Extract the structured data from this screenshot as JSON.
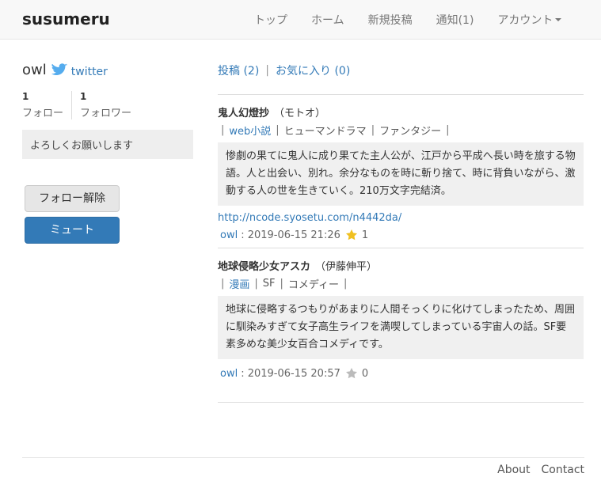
{
  "app": {
    "brand": "susumeru"
  },
  "nav": {
    "items": [
      "トップ",
      "ホーム",
      "新規投稿",
      "通知(1)"
    ],
    "account": "アカウント"
  },
  "profile": {
    "username": "owl",
    "twitter_label": "twitter",
    "follow_count": "1",
    "follow_label": "フォロー",
    "follower_count": "1",
    "follower_label": "フォロワー",
    "bio": "よろしくお願いします",
    "unfollow_button": "フォロー解除",
    "mute_button": "ミュート"
  },
  "tabs": {
    "posts": "投稿 (2)",
    "separator": "|",
    "favorites": "お気に入り (0)"
  },
  "posts": [
    {
      "title": "鬼人幻燈抄",
      "author": "（モトオ）",
      "category": "web小説",
      "tags": [
        "ヒューマンドラマ",
        "ファンタジー"
      ],
      "description": "惨劇の果てに鬼人に成り果てた主人公が、江戸から平成へ長い時を旅する物語。人と出会い、別れ。余分なものを時に斬り捨て、時に背負いながら、激動する人の世を生きていく。210万文字完結済。",
      "link": "http://ncode.syosetu.com/n4442da/",
      "user": "owl",
      "date": ": 2019-06-15 21:26",
      "favorited": true,
      "star_color": "#f0c020",
      "likes": "1"
    },
    {
      "title": "地球侵略少女アスカ",
      "author": "（伊藤伸平）",
      "category": "漫画",
      "tags": [
        "SF",
        "コメディー"
      ],
      "description": "地球に侵略するつもりがあまりに人間そっくりに化けてしまったため、周囲に馴染みすぎて女子高生ライフを満喫してしまっている宇宙人の話。SF要素多めな美少女百合コメディです。",
      "link": "",
      "user": "owl",
      "date": ": 2019-06-15 20:57",
      "favorited": false,
      "star_color": "#bbbbbb",
      "likes": "0"
    }
  ],
  "footer": {
    "about": "About",
    "contact": "Contact"
  },
  "colors": {
    "link": "#337ab7",
    "mute_button": "#337ab7",
    "twitter": "#55acee"
  }
}
